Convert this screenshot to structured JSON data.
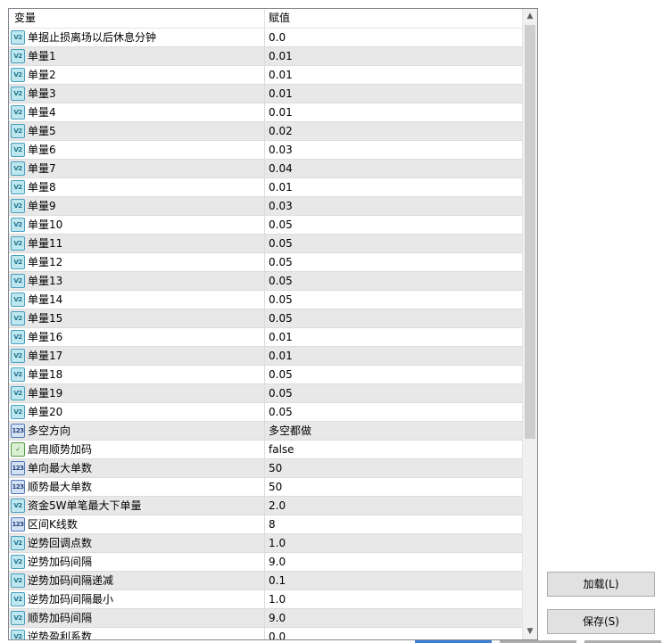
{
  "grid": {
    "columns": {
      "name": "变量",
      "value": "赋值"
    },
    "rows": [
      {
        "icon": "double-icon",
        "name": "单据止损离场以后休息分钟",
        "value": "0.0"
      },
      {
        "icon": "double-icon",
        "name": "单量1",
        "value": "0.01"
      },
      {
        "icon": "double-icon",
        "name": "单量2",
        "value": "0.01"
      },
      {
        "icon": "double-icon",
        "name": "单量3",
        "value": "0.01"
      },
      {
        "icon": "double-icon",
        "name": "单量4",
        "value": "0.01"
      },
      {
        "icon": "double-icon",
        "name": "单量5",
        "value": "0.02"
      },
      {
        "icon": "double-icon",
        "name": "单量6",
        "value": "0.03"
      },
      {
        "icon": "double-icon",
        "name": "单量7",
        "value": "0.04"
      },
      {
        "icon": "double-icon",
        "name": "单量8",
        "value": "0.01"
      },
      {
        "icon": "double-icon",
        "name": "单量9",
        "value": "0.03"
      },
      {
        "icon": "double-icon",
        "name": "单量10",
        "value": "0.05"
      },
      {
        "icon": "double-icon",
        "name": "单量11",
        "value": "0.05"
      },
      {
        "icon": "double-icon",
        "name": "单量12",
        "value": "0.05"
      },
      {
        "icon": "double-icon",
        "name": "单量13",
        "value": "0.05"
      },
      {
        "icon": "double-icon",
        "name": "单量14",
        "value": "0.05"
      },
      {
        "icon": "double-icon",
        "name": "单量15",
        "value": "0.05"
      },
      {
        "icon": "double-icon",
        "name": "单量16",
        "value": "0.01"
      },
      {
        "icon": "double-icon",
        "name": "单量17",
        "value": "0.01"
      },
      {
        "icon": "double-icon",
        "name": "单量18",
        "value": "0.05"
      },
      {
        "icon": "double-icon",
        "name": "单量19",
        "value": "0.05"
      },
      {
        "icon": "double-icon",
        "name": "单量20",
        "value": "0.05"
      },
      {
        "icon": "integer-icon",
        "name": "多空方向",
        "value": "多空都做"
      },
      {
        "icon": "bool-icon",
        "name": "启用顺势加码",
        "value": "false"
      },
      {
        "icon": "integer-icon",
        "name": "单向最大单数",
        "value": "50"
      },
      {
        "icon": "integer-icon",
        "name": "顺势最大单数",
        "value": "50"
      },
      {
        "icon": "double-icon",
        "name": "资金5W单笔最大下单量",
        "value": "2.0"
      },
      {
        "icon": "integer-icon",
        "name": "区间K线数",
        "value": "8"
      },
      {
        "icon": "double-icon",
        "name": "逆势回调点数",
        "value": "1.0"
      },
      {
        "icon": "double-icon",
        "name": "逆势加码间隔",
        "value": "9.0"
      },
      {
        "icon": "double-icon",
        "name": "逆势加码间隔递减",
        "value": "0.1"
      },
      {
        "icon": "double-icon",
        "name": "逆势加码间隔最小",
        "value": "1.0"
      },
      {
        "icon": "double-icon",
        "name": "顺势加码间隔",
        "value": "9.0"
      },
      {
        "icon": "double-icon",
        "name": "逆势盈利系数",
        "value": "0.0"
      }
    ]
  },
  "icon_glyphs": {
    "double-icon": "V2",
    "integer-icon": "123",
    "bool-icon": "✓"
  },
  "icon_classes": {
    "double-icon": "teal",
    "integer-icon": "blue",
    "bool-icon": "green"
  },
  "buttons": {
    "load": "加载(L)",
    "save": "保存(S)"
  },
  "scrollbar": {
    "up_arrow": "▲",
    "down_arrow": "▼"
  }
}
